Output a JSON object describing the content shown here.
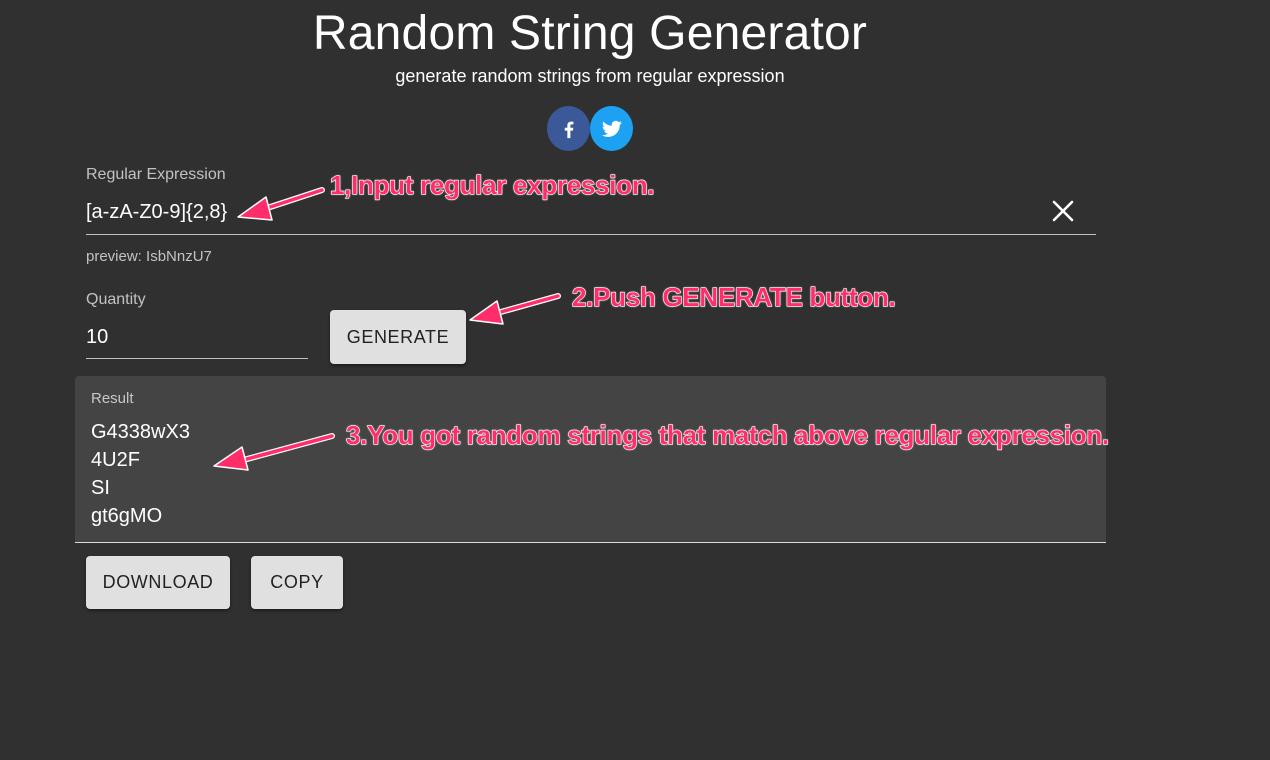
{
  "header": {
    "title": "Random String Generator",
    "subtitle": "generate random strings from regular expression"
  },
  "social": {
    "facebook_icon": "facebook-icon",
    "twitter_icon": "twitter-icon",
    "facebook_color": "#3b5998",
    "twitter_color": "#1da1f2"
  },
  "regex": {
    "label": "Regular Expression",
    "value": "[a-zA-Z0-9]{2,8}",
    "clear_icon": "close-icon"
  },
  "preview": {
    "text": "preview: IsbNnzU7"
  },
  "quantity": {
    "label": "Quantity",
    "value": "10"
  },
  "buttons": {
    "generate": "GENERATE",
    "download": "DOWNLOAD",
    "copy": "COPY"
  },
  "result": {
    "label": "Result",
    "lines": [
      "G4338wX3",
      "4U2F",
      "SI",
      "gt6gMO"
    ]
  },
  "annotations": {
    "step1": "1,Input regular expression.",
    "step2": "2.Push GENERATE button.",
    "step3": "3.You got random strings that match above regular expression.",
    "color": "#ff2e6a"
  },
  "colors": {
    "background": "#303030",
    "result_background": "#444444",
    "button_background": "#e0e0e0"
  }
}
